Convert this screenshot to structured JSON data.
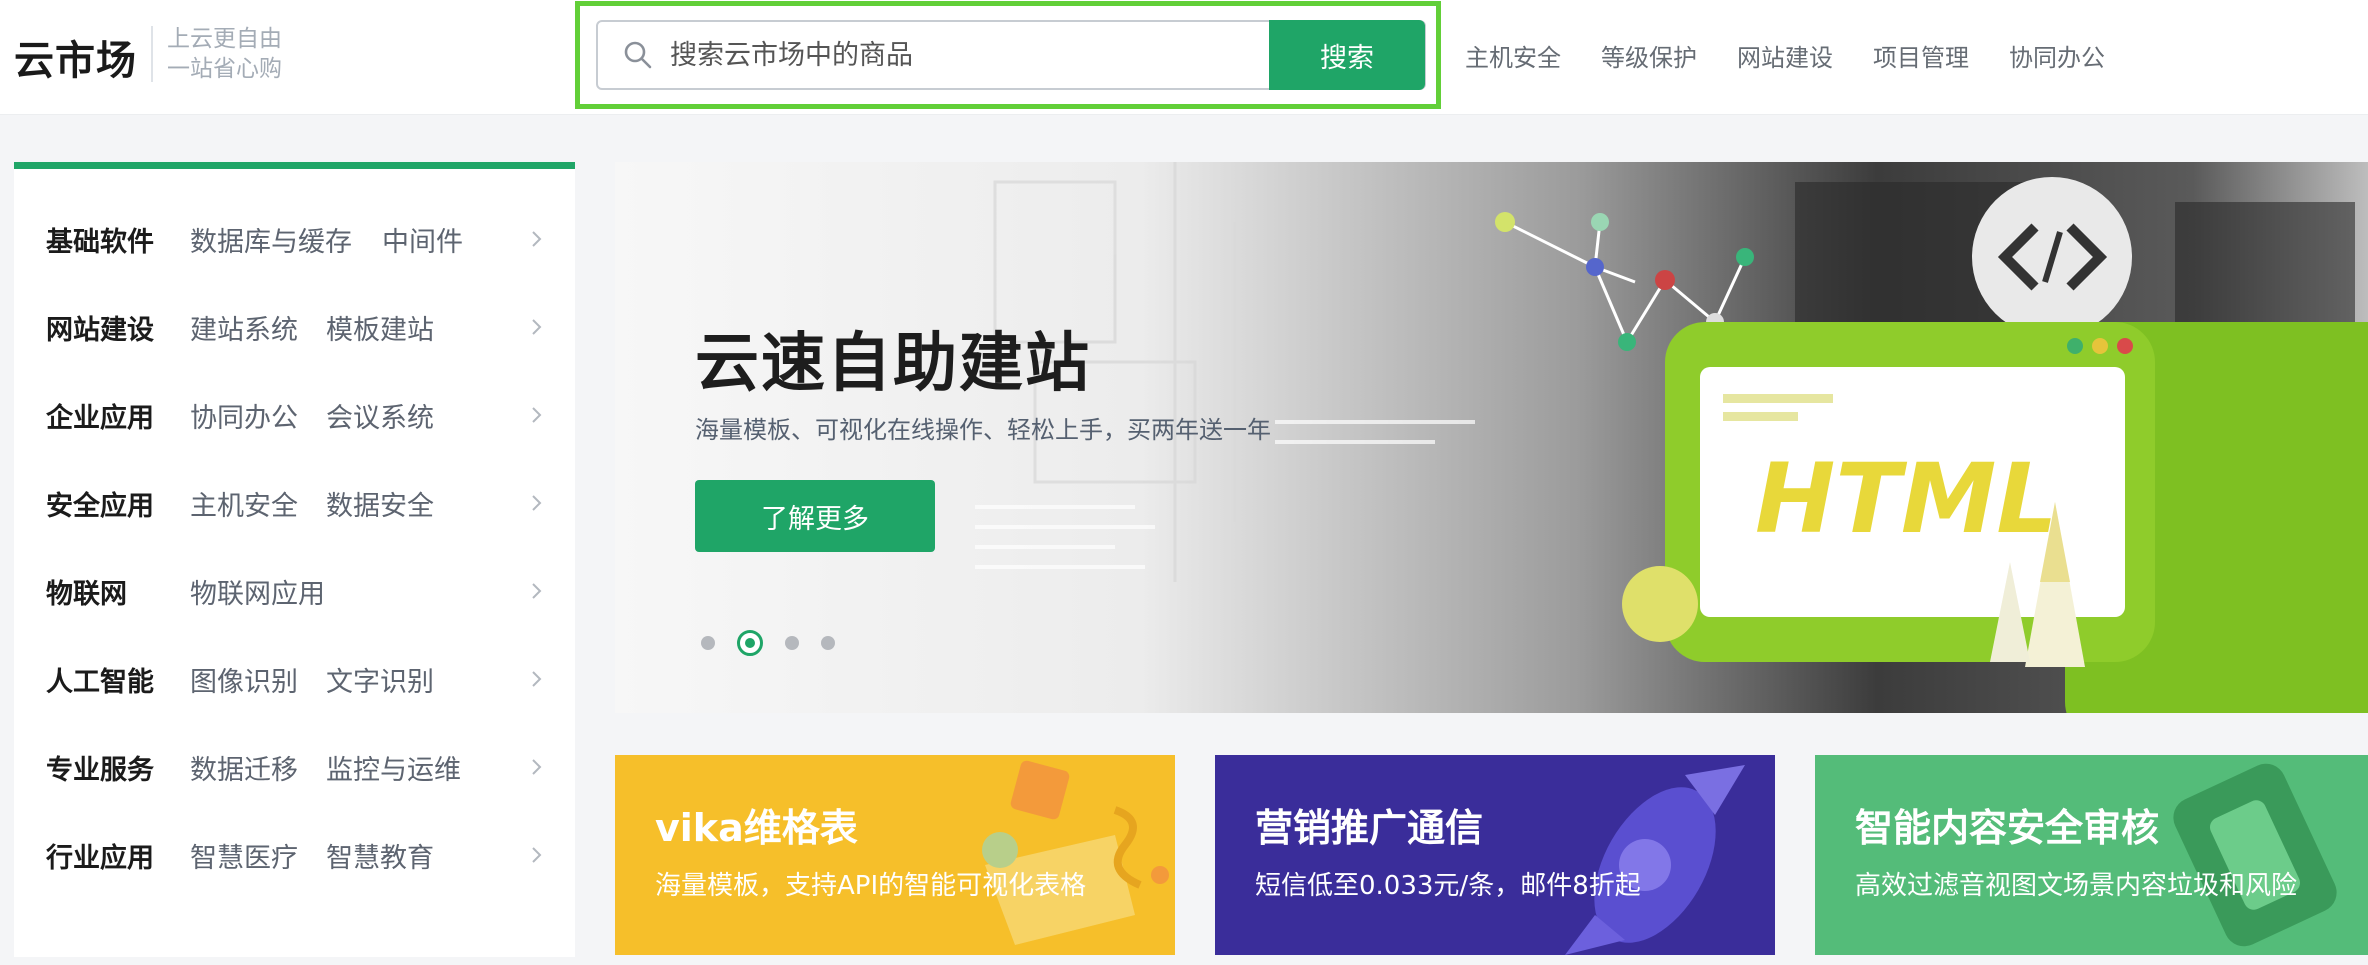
{
  "brand": {
    "logo": "云市场",
    "slogan_line1": "上云更自由",
    "slogan_line2": "一站省心购"
  },
  "search": {
    "placeholder": "搜索云市场中的商品",
    "button_label": "搜索"
  },
  "top_nav": [
    "主机安全",
    "等级保护",
    "网站建设",
    "项目管理",
    "协同办公"
  ],
  "categories": [
    {
      "title": "基础软件",
      "subs": [
        "数据库与缓存",
        "中间件"
      ]
    },
    {
      "title": "网站建设",
      "subs": [
        "建站系统",
        "模板建站"
      ]
    },
    {
      "title": "企业应用",
      "subs": [
        "协同办公",
        "会议系统"
      ]
    },
    {
      "title": "安全应用",
      "subs": [
        "主机安全",
        "数据安全"
      ]
    },
    {
      "title": "物联网",
      "subs": [
        "物联网应用"
      ]
    },
    {
      "title": "人工智能",
      "subs": [
        "图像识别",
        "文字识别"
      ]
    },
    {
      "title": "专业服务",
      "subs": [
        "数据迁移",
        "监控与运维"
      ]
    },
    {
      "title": "行业应用",
      "subs": [
        "智慧医疗",
        "智慧教育"
      ]
    }
  ],
  "banner": {
    "title": "云速自助建站",
    "subtitle": "海量模板、可视化在线操作、轻松上手，买两年送一年",
    "button_label": "了解更多",
    "art_text": "HTML",
    "slide_count": 4,
    "active_slide": 2
  },
  "promos": [
    {
      "title": "vika维格表",
      "desc": "海量模板，支持API的智能可视化表格",
      "color": "#f6bf2a"
    },
    {
      "title": "营销推广通信",
      "desc": "短信低至0.033元/条，邮件8折起",
      "color": "#3a2d9a"
    },
    {
      "title": "智能内容安全审核",
      "desc": "高效过滤音视图文场景内容垃圾和风险",
      "color": "#54bc79"
    }
  ],
  "colors": {
    "accent": "#1fa567",
    "highlight_outline": "#62cf38"
  }
}
